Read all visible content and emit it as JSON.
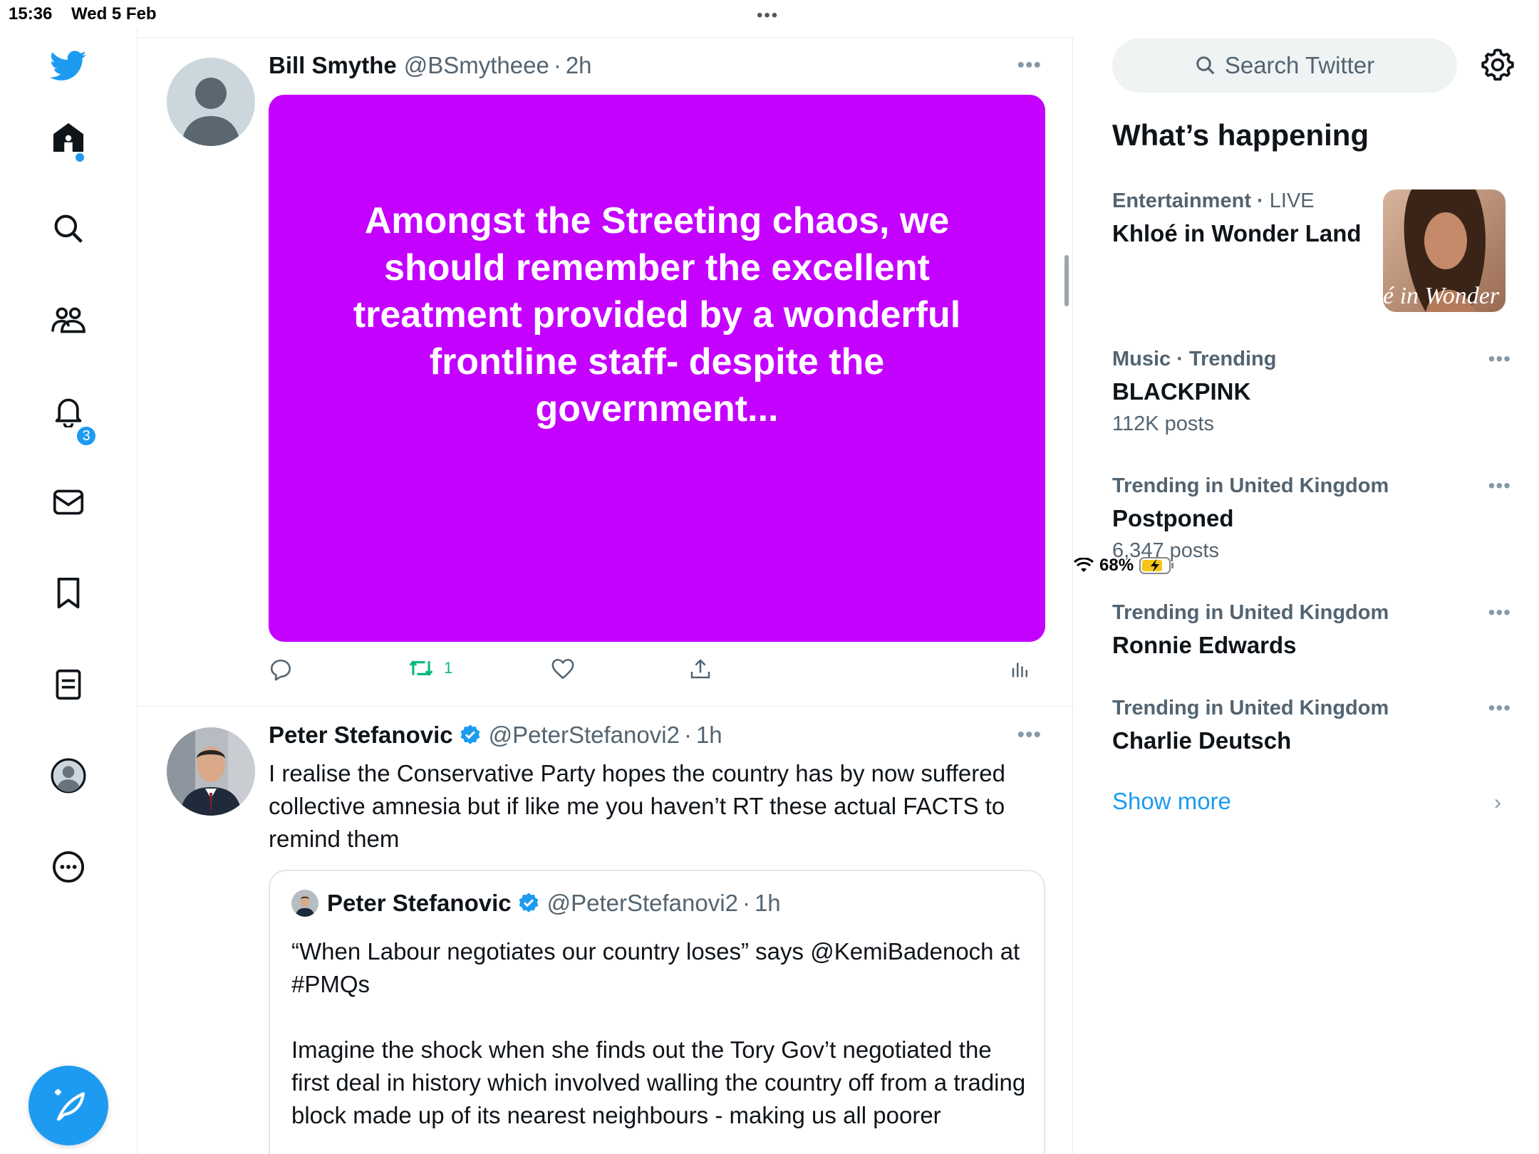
{
  "status": {
    "time": "15:36",
    "date": "Wed 5 Feb",
    "multitask": "•••",
    "battery": "68%"
  },
  "nav": {
    "notifications_badge": "3",
    "accent": "#1d9bf0"
  },
  "tweets": [
    {
      "name": "Bill Smythe",
      "handle": "@BSmytheee",
      "separator": "·",
      "time": "2h",
      "more": "•••",
      "media_text": "Amongst the Streeting chaos, we should remember the excellent treatment provided by a wonderful frontline staff- despite the government...",
      "media_color": "#c400ff",
      "retweets": "1"
    },
    {
      "name": "Peter Stefanovic",
      "handle": "@PeterStefanovi2",
      "separator": "·",
      "time": "1h",
      "more": "•••",
      "body": "I realise the Conservative Party hopes the country has by now suffered collective amnesia but if like me you haven’t RT these actual FACTS to remind them",
      "quote": {
        "name": "Peter Stefanovic",
        "handle": "@PeterStefanovi2",
        "separator": "·",
        "time": "1h",
        "body_line1": "“When Labour negotiates our country loses” says @KemiBadenoch at #PMQs",
        "body_line2": "Imagine the shock when she finds out the Tory Gov’t negotiated the first deal in history which involved walling the country off from a trading block made up of its nearest neighbours - making us all poorer"
      }
    }
  ],
  "sidebar": {
    "search_placeholder": "Search Twitter",
    "whats_happening": "What’s happening",
    "trends": [
      {
        "category": "Entertainment",
        "sep": "·",
        "extra": "LIVE",
        "title": "Khloé in Wonder Land",
        "count": "",
        "thumb_text": "é in Wonder l"
      },
      {
        "category": "Music",
        "sep": "·",
        "extra": "Trending",
        "title": "BLACKPINK",
        "count": "112K posts"
      },
      {
        "category": "Trending in United Kingdom",
        "sep": "",
        "extra": "",
        "title": "Postponed",
        "count": "6,347 posts"
      },
      {
        "category": "Trending in United Kingdom",
        "sep": "",
        "extra": "",
        "title": "Ronnie Edwards",
        "count": ""
      },
      {
        "category": "Trending in United Kingdom",
        "sep": "",
        "extra": "",
        "title": "Charlie Deutsch",
        "count": ""
      }
    ],
    "more_dots": "•••",
    "show_more": "Show more",
    "chevron": "›"
  }
}
